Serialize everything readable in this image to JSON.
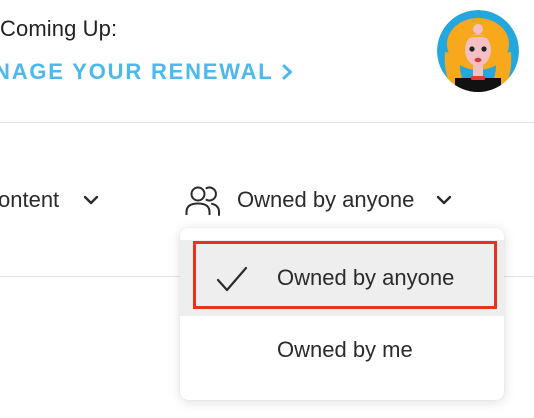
{
  "header": {
    "coming_up_label": "Coming Up:",
    "renewal_link_label": "NAGE YOUR RENEWAL",
    "renewal_color": "#4db8ee"
  },
  "avatar": {
    "icon": "user-avatar-illustration"
  },
  "filters": {
    "content_label": "ontent",
    "owner_label": "Owned by anyone"
  },
  "dropdown": {
    "options": [
      {
        "label": "Owned by anyone",
        "selected": true
      },
      {
        "label": "Owned by me",
        "selected": false
      }
    ],
    "highlight_color": "#e8321e"
  }
}
